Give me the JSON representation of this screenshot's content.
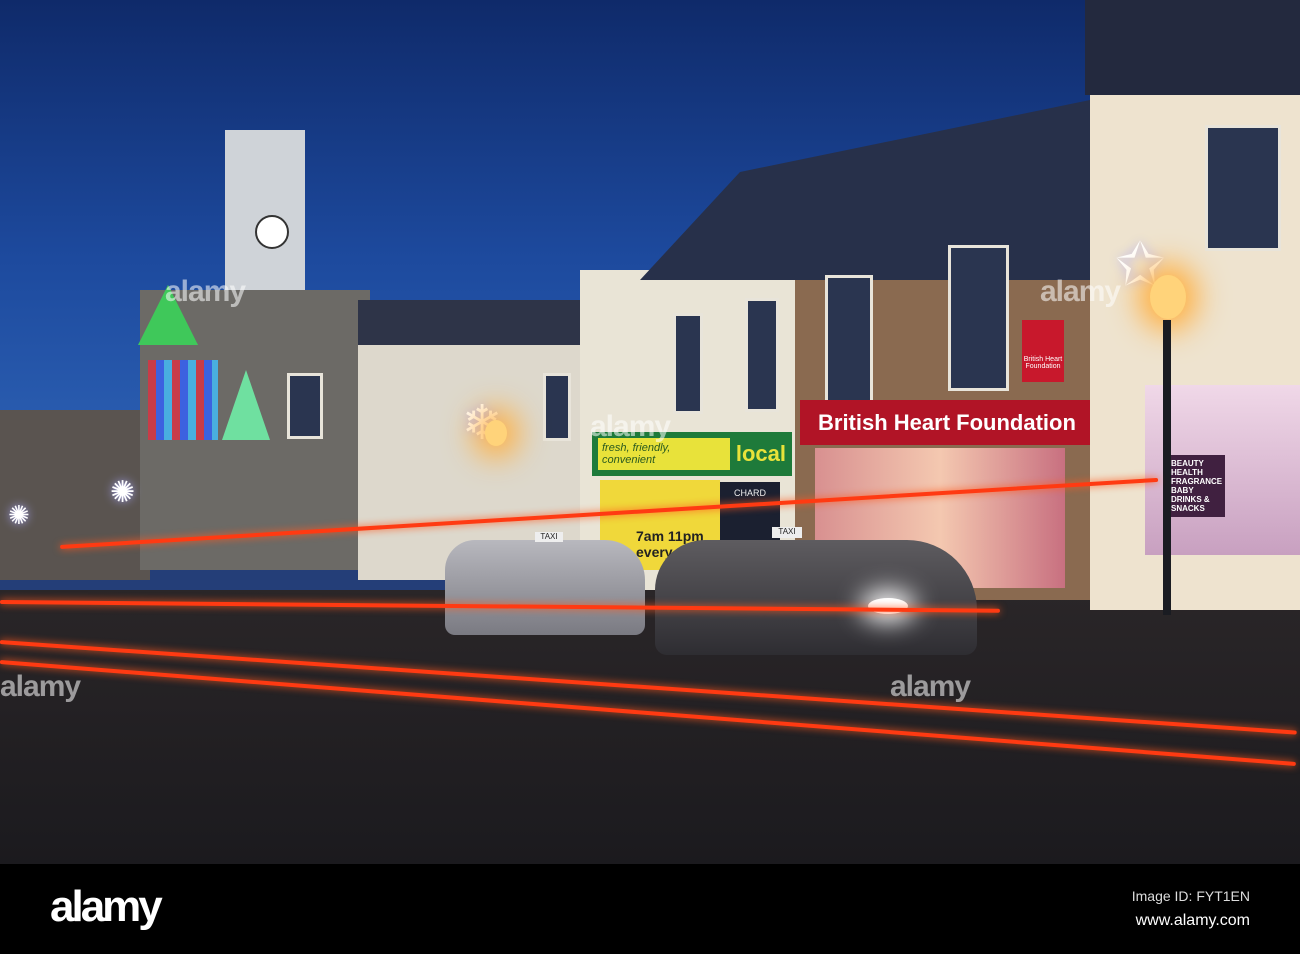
{
  "signs": {
    "bhf_fascia": "British Heart Foundation",
    "bhf_logo": "British Heart Foundation",
    "local_tagline": "fresh, friendly, convenient",
    "local_brand": "local",
    "local_hours": "7am 11pm every",
    "kiosk": "CHARD",
    "taxi_1": "TAXI",
    "taxi_2": "TAXI",
    "superdrug_window": "BEAUTY HEALTH FRAGRANCE BABY DRINKS & SNACKS"
  },
  "watermark": {
    "text": "alamy"
  },
  "footer": {
    "logo": "alamy",
    "image_id": "Image ID: FYT1EN",
    "url": "www.alamy.com"
  }
}
